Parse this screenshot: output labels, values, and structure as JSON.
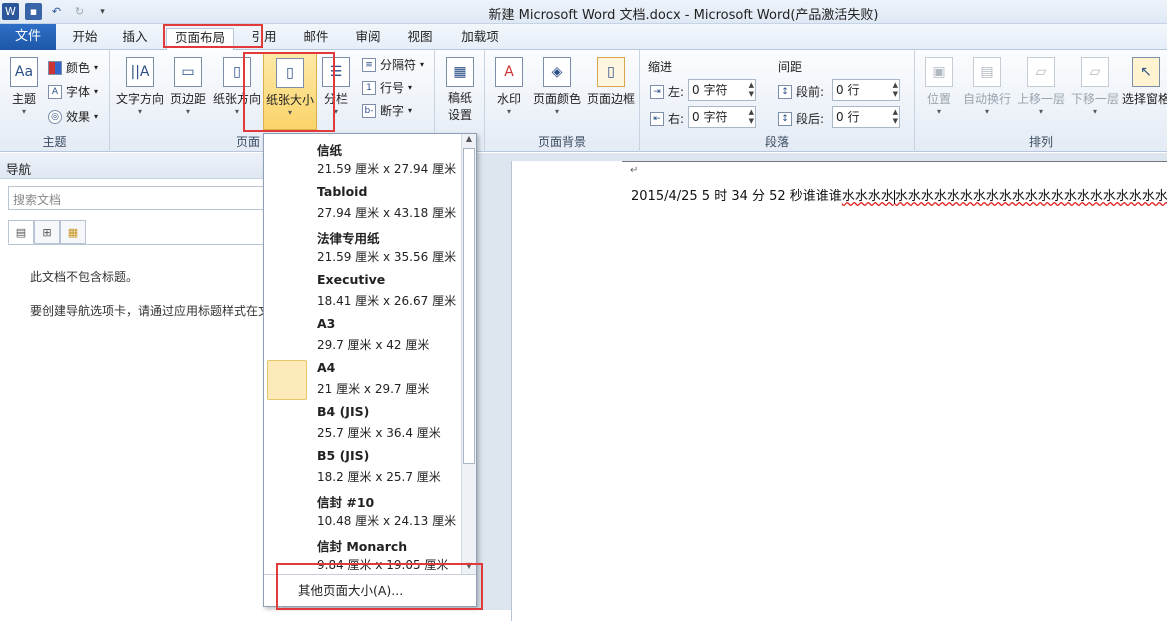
{
  "window": {
    "title": "新建 Microsoft Word 文档.docx - Microsoft Word(产品激活失败)"
  },
  "qat": {
    "app_icon": "W",
    "save_icon": "save-icon",
    "undo_icon": "undo-icon",
    "redo_icon": "redo-icon"
  },
  "tabs": {
    "file": "文件",
    "home": "开始",
    "insert": "插入",
    "layout": "页面布局",
    "references": "引用",
    "mailings": "邮件",
    "review": "审阅",
    "view": "视图",
    "addins": "加载项"
  },
  "ribbon": {
    "themes": {
      "label": "主题",
      "theme": "主题",
      "colors": "颜色",
      "fonts": "字体",
      "effects": "效果"
    },
    "page_setup": {
      "label": "页面",
      "text_direction": "文字方向",
      "margins": "页边距",
      "orientation": "纸张方向",
      "size": "纸张大小",
      "columns": "分栏",
      "breaks": "分隔符",
      "line_numbers": "行号",
      "hyphenation": "断字"
    },
    "manuscript": {
      "label": "稿纸设置"
    },
    "page_background": {
      "label": "页面背景",
      "watermark": "水印",
      "page_color": "页面颜色",
      "page_borders": "页面边框"
    },
    "paragraph": {
      "label": "段落",
      "indent": "缩进",
      "left": "左:",
      "right": "右:",
      "left_value": "0 字符",
      "right_value": "0 字符",
      "spacing": "间距",
      "before": "段前:",
      "after": "段后:",
      "before_value": "0 行",
      "after_value": "0 行"
    },
    "arrange": {
      "label": "排列",
      "position": "位置",
      "wrap": "自动换行",
      "forward": "上移一层",
      "backward": "下移一层",
      "selection": "选择窗格"
    }
  },
  "nav": {
    "title": "导航",
    "search_placeholder": "搜索文档",
    "msg1": "此文档不包含标题。",
    "msg2": "要创建导航选项卡，请通过应用标题样式在文"
  },
  "document": {
    "para_mark": "↵",
    "text_plain": "2015/4/25 5 时 34 分 52 秒谁谁谁",
    "text_wavy1": "水水水水",
    "text_wavy2": "水水水水水水水水水水水水水水水水水水水水水"
  },
  "paper_sizes": [
    {
      "name": "信纸",
      "size": "21.59 厘米 x 27.94 厘米"
    },
    {
      "name": "Tabloid",
      "size": "27.94 厘米 x 43.18 厘米"
    },
    {
      "name": "法律专用纸",
      "size": "21.59 厘米 x 35.56 厘米"
    },
    {
      "name": "Executive",
      "size": "18.41 厘米 x 26.67 厘米"
    },
    {
      "name": "A3",
      "size": "29.7 厘米 x 42 厘米"
    },
    {
      "name": "A4",
      "size": "21 厘米 x 29.7 厘米",
      "selected": true
    },
    {
      "name": "B4 (JIS)",
      "size": "25.7 厘米 x 36.4 厘米"
    },
    {
      "name": "B5 (JIS)",
      "size": "18.2 厘米 x 25.7 厘米"
    },
    {
      "name": "信封 #10",
      "size": "10.48 厘米 x 24.13 厘米"
    },
    {
      "name": "信封 Monarch",
      "size": "9.84 厘米 x 19.05 厘米"
    }
  ],
  "more_sizes": "其他页面大小(A)...",
  "colors": {
    "accent": "#2e6fc6",
    "highlight": "#e03a3a",
    "selected": "#fcebb8"
  }
}
